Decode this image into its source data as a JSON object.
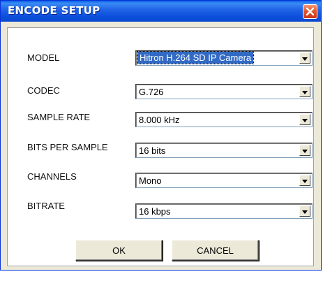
{
  "window": {
    "title": "ENCODE SETUP",
    "close_icon": "close-icon"
  },
  "form": {
    "rows": [
      {
        "label": "MODEL",
        "value": "Hitron H.264 SD IP Camera"
      },
      {
        "label": "CODEC",
        "value": "G.726"
      },
      {
        "label": "SAMPLE RATE",
        "value": "8.000 kHz"
      },
      {
        "label": "BITS PER SAMPLE",
        "value": "16 bits"
      },
      {
        "label": "CHANNELS",
        "value": "Mono"
      },
      {
        "label": "BITRATE",
        "value": "16 kbps"
      }
    ]
  },
  "buttons": {
    "ok_label": "OK",
    "cancel_label": "CANCEL"
  },
  "colors": {
    "titlebar": "#0a49cf",
    "close": "#e3572b",
    "selection": "#316ac5"
  }
}
